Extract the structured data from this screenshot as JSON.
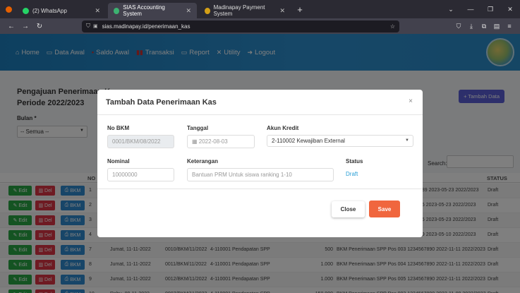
{
  "browser": {
    "tabs": [
      {
        "label": "(2) WhatsApp",
        "color": "#25d366"
      },
      {
        "label": "SIAS Accounting System",
        "color": "#3cb371"
      },
      {
        "label": "Madinapay Payment System",
        "color": "#d4a017"
      }
    ],
    "new_tab": "+",
    "url": "sias.madinapay.id/penerimaan_kas"
  },
  "header": {
    "menu": [
      {
        "label": "Home",
        "icon": "home-icon"
      },
      {
        "label": "Data Awal",
        "icon": "monitor-icon"
      },
      {
        "label": "Saldo Awal",
        "icon": "wallet-icon"
      },
      {
        "label": "Transaksi",
        "icon": "bars-icon"
      },
      {
        "label": "Report",
        "icon": "monitor-icon"
      },
      {
        "label": "Utility",
        "icon": "tools-icon"
      },
      {
        "label": "Logout",
        "icon": "logout-icon"
      }
    ]
  },
  "page": {
    "title_line1": "Pengajuan Penerimaan Kas",
    "title_line2": "Periode 2022/2023",
    "add_button": "+ Tambah Data",
    "bulan_label": "Bulan *",
    "bulan_value": "-- Semua --",
    "search_label": "Search:"
  },
  "table": {
    "headers": {
      "no": "NO",
      "status": "STATUS"
    },
    "actions": {
      "edit": "Edit",
      "del": "Del",
      "bkm": "BKM"
    },
    "rows": [
      {
        "no": "1",
        "date": "",
        "bkm": "",
        "akun": "",
        "nominal": "",
        "ket": "789 2023-05-23 2022/2023",
        "status": "Draft"
      },
      {
        "no": "2",
        "date": "",
        "bkm": "",
        "akun": "",
        "nominal": "",
        "ket": "05 2023-05-23 2022/2023",
        "status": "Draft"
      },
      {
        "no": "3",
        "date": "",
        "bkm": "",
        "akun": "",
        "nominal": "",
        "ket": "05 2023-05-23 2022/2023",
        "status": "Draft"
      },
      {
        "no": "4",
        "date": "",
        "bkm": "",
        "akun": "",
        "nominal": "",
        "ket": "09 2023-05-10 2022/2023",
        "status": "Draft"
      },
      {
        "no": "7",
        "date": "Jumat, 11-11-2022",
        "bkm": "0010/BKM/11/2022",
        "akun": "4-110001 Pendapatan SPP",
        "nominal": "500",
        "ket": "BKM Penerimaan SPP Pos 003 1234567890 2022-11-11 2022/2023",
        "status": "Draft"
      },
      {
        "no": "8",
        "date": "Jumat, 11-11-2022",
        "bkm": "0011/BKM/11/2022",
        "akun": "4-110001 Pendapatan SPP",
        "nominal": "1.000",
        "ket": "BKM Penerimaan SPP Pos 004 1234567890 2022-11-11 2022/2023",
        "status": "Draft"
      },
      {
        "no": "9",
        "date": "Jumat, 11-11-2022",
        "bkm": "0012/BKM/11/2022",
        "akun": "4-110001 Pendapatan SPP",
        "nominal": "1.000",
        "ket": "BKM Penerimaan SPP Pos 005 1234567890 2022-11-11 2022/2023",
        "status": "Draft"
      },
      {
        "no": "10",
        "date": "Rabu, 09-11-2022",
        "bkm": "0007/BKM/11/2022",
        "akun": "4-110001 Pendapatan SPP",
        "nominal": "150.000",
        "ket": "BKM Penerimaan SPP Pos 003 1234567890 2022-11-09 2022/2023",
        "status": "Draft"
      }
    ]
  },
  "modal": {
    "title": "Tambah Data Penerimaan Kas",
    "close_x": "×",
    "no_bkm_label": "No BKM",
    "no_bkm_value": "0001/BKM/08/2022",
    "tanggal_label": "Tanggal",
    "tanggal_value": "2022-08-03",
    "akun_label": "Akun Kredit",
    "akun_value": "2-110002 Kewajiban External",
    "nominal_label": "Nominal",
    "nominal_value": "10000000",
    "keterangan_label": "Keterangan",
    "keterangan_value": "Bantuan PRM Untuk siswa ranking 1-10",
    "status_label": "Status",
    "status_value": "Draft",
    "close_button": "Close",
    "save_button": "Save"
  }
}
